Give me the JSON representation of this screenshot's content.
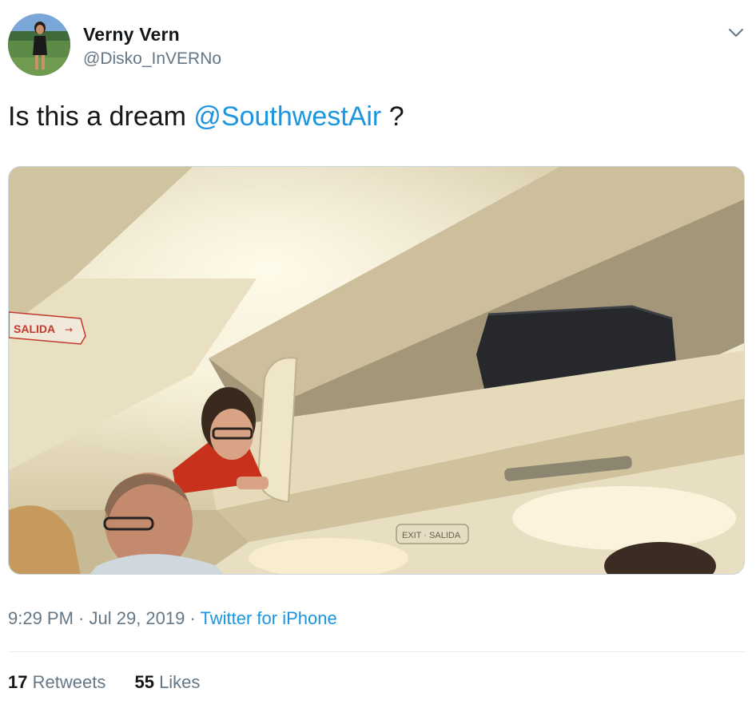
{
  "user": {
    "display_name": "Verny Vern",
    "handle": "@Disko_InVERNo"
  },
  "tweet": {
    "text_before": "Is this a dream ",
    "mention": "@SouthwestAir",
    "text_after": " ?"
  },
  "meta": {
    "time": "9:29 PM",
    "separator1": " · ",
    "date": "Jul 29, 2019",
    "separator2": " · ",
    "source": "Twitter for iPhone"
  },
  "stats": {
    "retweets_count": "17",
    "retweets_label": "Retweets",
    "likes_count": "55",
    "likes_label": "Likes"
  },
  "photo_signs": {
    "exit_sign": "SALIDA",
    "ceiling_sign": "EXIT · SALIDA"
  },
  "icons": {
    "caret": "chevron-down-icon"
  },
  "colors": {
    "link": "#1b95e0",
    "secondary_text": "#657786",
    "primary_text": "#14171a"
  }
}
